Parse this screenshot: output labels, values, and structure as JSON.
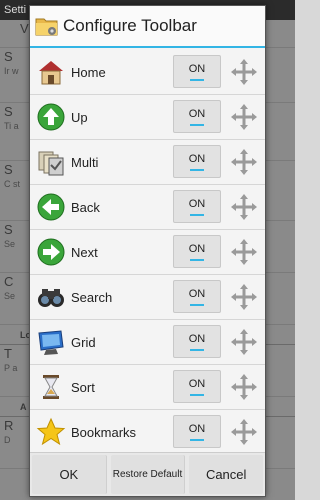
{
  "background": {
    "title": "Setti",
    "rows": [
      {
        "t": "V",
        "s": ""
      },
      {
        "t": "S",
        "s": "Ir w"
      },
      {
        "t": "S",
        "s": "Ti a"
      },
      {
        "t": "S",
        "s": "C st"
      },
      {
        "t": "S",
        "s": "Se"
      },
      {
        "t": "C",
        "s": "Se"
      }
    ],
    "head1": "Lo",
    "rows2": [
      {
        "t": "T",
        "s": "P a"
      }
    ],
    "head2": "A",
    "rows3": [
      {
        "t": "R",
        "s": "D"
      }
    ]
  },
  "dialog": {
    "title": "Configure Toolbar",
    "items": [
      {
        "label": "Home",
        "toggle": "ON",
        "icon": "home-icon"
      },
      {
        "label": "Up",
        "toggle": "ON",
        "icon": "up-arrow-icon"
      },
      {
        "label": "Multi",
        "toggle": "ON",
        "icon": "multi-select-icon"
      },
      {
        "label": "Back",
        "toggle": "ON",
        "icon": "back-arrow-icon"
      },
      {
        "label": "Next",
        "toggle": "ON",
        "icon": "next-arrow-icon"
      },
      {
        "label": "Search",
        "toggle": "ON",
        "icon": "binoculars-icon"
      },
      {
        "label": "Grid",
        "toggle": "ON",
        "icon": "grid-monitor-icon"
      },
      {
        "label": "Sort",
        "toggle": "ON",
        "icon": "hourglass-icon"
      },
      {
        "label": "Bookmarks",
        "toggle": "ON",
        "icon": "star-icon"
      }
    ],
    "buttons": {
      "ok": "OK",
      "restore": "Restore Default",
      "cancel": "Cancel"
    }
  },
  "colors": {
    "accent": "#33b5e5",
    "green": "#3aa53a"
  }
}
